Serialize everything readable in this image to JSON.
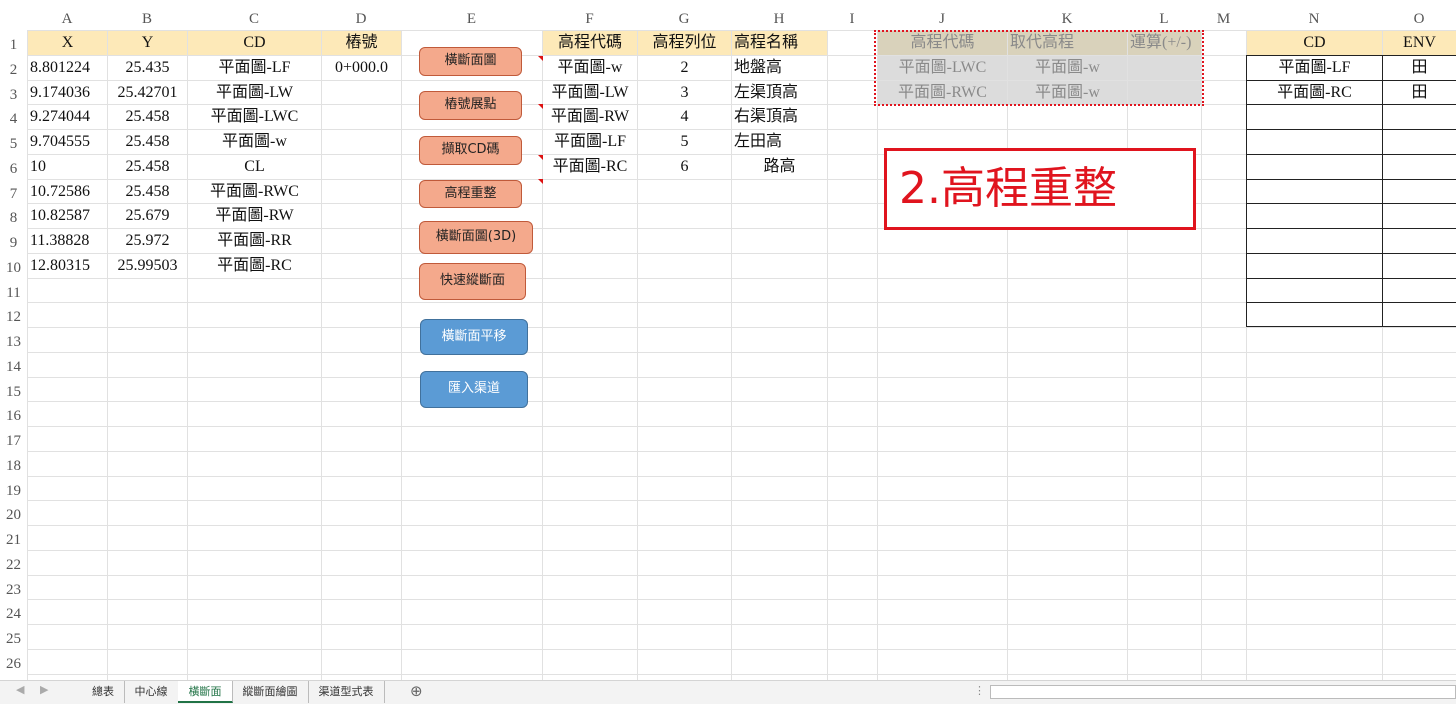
{
  "columns": [
    {
      "letter": "A"
    },
    {
      "letter": "B"
    },
    {
      "letter": "C"
    },
    {
      "letter": "D"
    },
    {
      "letter": "E"
    },
    {
      "letter": "F"
    },
    {
      "letter": "G"
    },
    {
      "letter": "H"
    },
    {
      "letter": "I"
    },
    {
      "letter": "J"
    },
    {
      "letter": "K"
    },
    {
      "letter": "L"
    },
    {
      "letter": "M"
    },
    {
      "letter": "N"
    },
    {
      "letter": "O"
    }
  ],
  "rows": [
    "1",
    "2",
    "3",
    "4",
    "5",
    "6",
    "7",
    "8",
    "9",
    "10",
    "11",
    "12",
    "13",
    "14",
    "15",
    "16",
    "17",
    "18",
    "19",
    "20",
    "21",
    "22",
    "23",
    "24",
    "25",
    "26"
  ],
  "table_main": {
    "headers": {
      "x": "X",
      "y": "Y",
      "cd": "CD",
      "station": "樁號"
    },
    "data": [
      {
        "x": "8.801224",
        "y": "25.435",
        "cd": "平面圖-LF",
        "station": "0+000.0"
      },
      {
        "x": "9.174036",
        "y": "25.42701",
        "cd": "平面圖-LW",
        "station": ""
      },
      {
        "x": "9.274044",
        "y": "25.458",
        "cd": "平面圖-LWC",
        "station": ""
      },
      {
        "x": "9.704555",
        "y": "25.458",
        "cd": "平面圖-w",
        "station": ""
      },
      {
        "x": "10",
        "y": "25.458",
        "cd": "CL",
        "station": ""
      },
      {
        "x": "10.72586",
        "y": "25.458",
        "cd": "平面圖-RWC",
        "station": ""
      },
      {
        "x": "10.82587",
        "y": "25.679",
        "cd": "平面圖-RW",
        "station": ""
      },
      {
        "x": "11.38828",
        "y": "25.972",
        "cd": "平面圖-RR",
        "station": ""
      },
      {
        "x": "12.80315",
        "y": "25.99503",
        "cd": "平面圖-RC",
        "station": ""
      }
    ]
  },
  "buttons": [
    {
      "label": "橫斷面圖"
    },
    {
      "label": "樁號展點"
    },
    {
      "label": "擷取CD碼"
    },
    {
      "label": "高程重整"
    },
    {
      "label": "橫斷面圖(3D)"
    },
    {
      "label": "快速縱斷面"
    },
    {
      "label": "橫斷面平移"
    },
    {
      "label": "匯入渠道"
    }
  ],
  "table_elev": {
    "headers": {
      "code": "高程代碼",
      "col": "高程列位",
      "name": "高程名稱"
    },
    "data": [
      {
        "code": "平面圖-w",
        "col": "2",
        "name": "地盤高"
      },
      {
        "code": "平面圖-LW",
        "col": "3",
        "name": "左渠頂高"
      },
      {
        "code": "平面圖-RW",
        "col": "4",
        "name": "右渠頂高"
      },
      {
        "code": "平面圖-LF",
        "col": "5",
        "name": "左田高"
      },
      {
        "code": "平面圖-RC",
        "col": "6",
        "name": "路高"
      }
    ]
  },
  "table_replace": {
    "headers": {
      "code": "高程代碼",
      "replace": "取代高程",
      "calc": "運算(+/-)"
    },
    "data": [
      {
        "code": "平面圖-LWC",
        "replace": "平面圖-w",
        "calc": ""
      },
      {
        "code": "平面圖-RWC",
        "replace": "平面圖-w",
        "calc": ""
      }
    ]
  },
  "callout": "2.高程重整",
  "table_env": {
    "headers": {
      "cd": "CD",
      "env": "ENV"
    },
    "data": [
      {
        "cd": "平面圖-LF",
        "env": "田"
      },
      {
        "cd": "平面圖-RC",
        "env": "田"
      }
    ]
  },
  "sheet_tabs": [
    {
      "label": "總表",
      "active": false
    },
    {
      "label": "中心線",
      "active": false
    },
    {
      "label": "橫斷面",
      "active": true
    },
    {
      "label": "縱斷面繪圖",
      "active": false
    },
    {
      "label": "渠道型式表",
      "active": false
    }
  ],
  "add_sheet_symbol": "⊕",
  "colors": {
    "header_fill": "#fde9b8",
    "button_orange": "#f4a98c",
    "button_blue": "#5b9bd5",
    "accent_red": "#e0141e"
  }
}
